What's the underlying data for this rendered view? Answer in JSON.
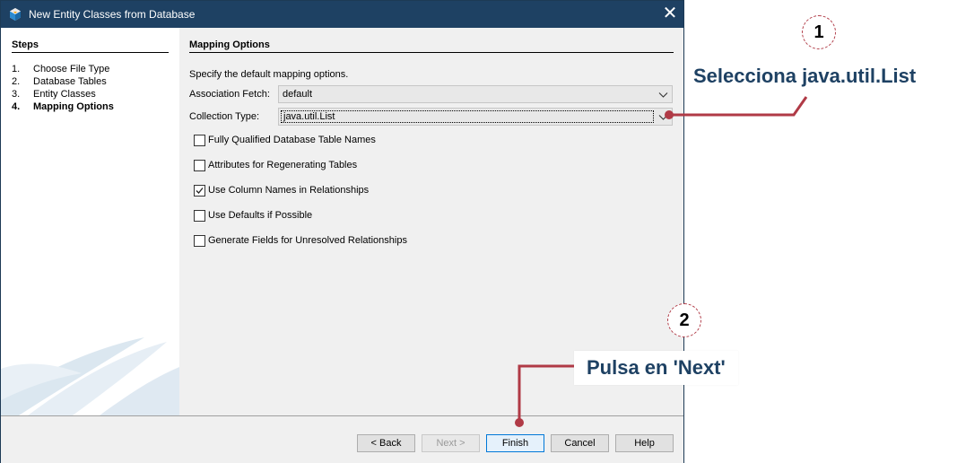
{
  "window": {
    "title": "New Entity Classes from Database",
    "close_glyph": "✕"
  },
  "steps": {
    "heading": "Steps",
    "items": [
      {
        "num": "1.",
        "label": "Choose File Type"
      },
      {
        "num": "2.",
        "label": "Database Tables"
      },
      {
        "num": "3.",
        "label": "Entity Classes"
      },
      {
        "num": "4.",
        "label": "Mapping Options",
        "current": true
      }
    ]
  },
  "content": {
    "title": "Mapping Options",
    "description": "Specify the default mapping options.",
    "association_fetch": {
      "label": "Association Fetch:",
      "value": "default"
    },
    "collection_type": {
      "label": "Collection Type:",
      "value": "java.util.List"
    },
    "checkboxes": [
      {
        "label": "Fully Qualified Database Table Names",
        "checked": false
      },
      {
        "label": "Attributes for Regenerating Tables",
        "checked": false
      },
      {
        "label": "Use Column Names in Relationships",
        "checked": true
      },
      {
        "label": "Use Defaults if Possible",
        "checked": false
      },
      {
        "label": "Generate Fields for Unresolved Relationships",
        "checked": false
      }
    ]
  },
  "buttons": {
    "back": "< Back",
    "next": "Next >",
    "finish": "Finish",
    "cancel": "Cancel",
    "help": "Help"
  },
  "annotations": {
    "step1_number": "1",
    "step1_text": "Selecciona java.util.List",
    "step2_number": "2",
    "step2_text": "Pulsa en 'Next'",
    "accent_color": "#b03a46",
    "text_color": "#1e4163"
  }
}
